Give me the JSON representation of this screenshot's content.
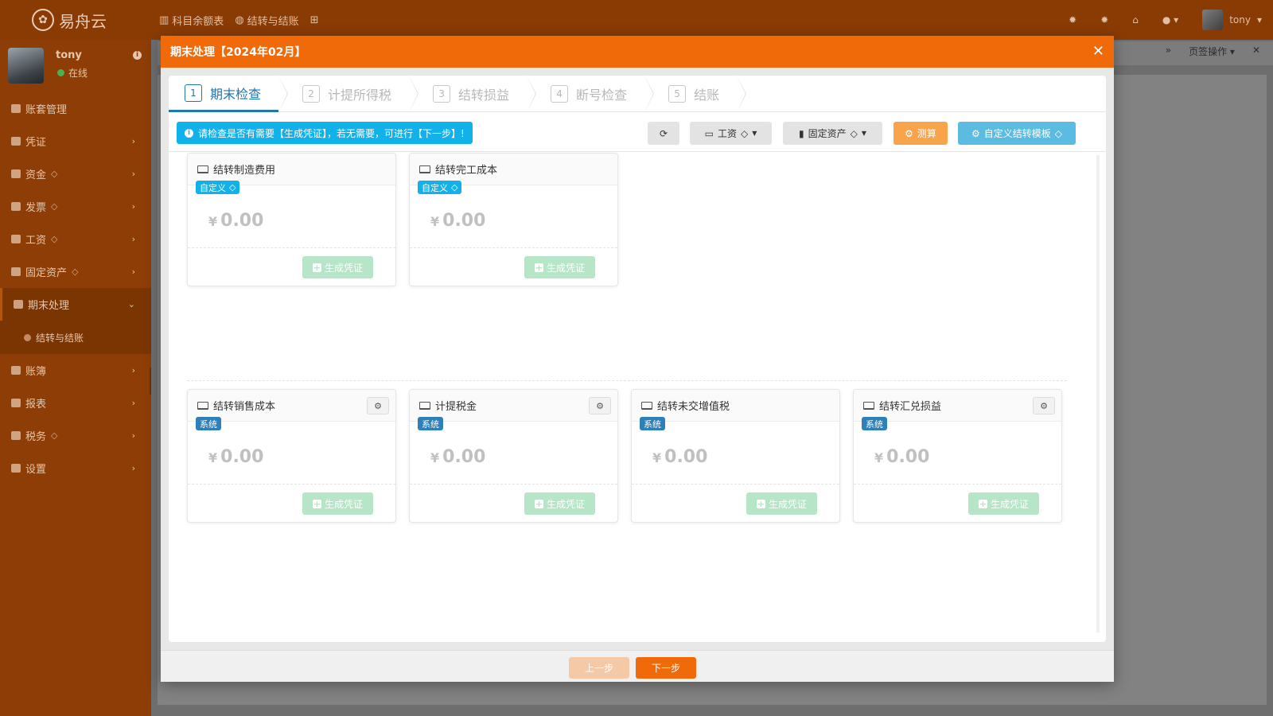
{
  "app": {
    "logo_text": "易舟云",
    "top_tabs": [
      "科目余额表",
      "结转与结账"
    ],
    "top_user": "tony",
    "page_ops": "页签操作"
  },
  "sidebar": {
    "user_name": "tony",
    "user_status": "在线",
    "items": [
      {
        "label": "账套管理"
      },
      {
        "label": "凭证"
      },
      {
        "label": "资金"
      },
      {
        "label": "发票"
      },
      {
        "label": "工资"
      },
      {
        "label": "固定资产"
      },
      {
        "label": "期末处理"
      },
      {
        "label": "结转与结账"
      },
      {
        "label": "账簿"
      },
      {
        "label": "报表"
      },
      {
        "label": "税务"
      },
      {
        "label": "设置"
      }
    ]
  },
  "modal": {
    "title": "期末处理【2024年02月】",
    "steps": [
      {
        "num": "1",
        "label": "期末检查"
      },
      {
        "num": "2",
        "label": "计提所得税"
      },
      {
        "num": "3",
        "label": "结转损益"
      },
      {
        "num": "4",
        "label": "断号检查"
      },
      {
        "num": "5",
        "label": "结账"
      }
    ],
    "alert": "请检查是否有需要【生成凭证】，若无需要，可进行【下一步】!",
    "toolbar": {
      "salary": "工资",
      "fixed_assets": "固定资产",
      "calculate": "测算",
      "custom_template": "自定义结转模板"
    },
    "cards": [
      {
        "title": "结转制造费用",
        "badge": "自定义",
        "amount": "0.00",
        "button": "生成凭证"
      },
      {
        "title": "结转完工成本",
        "badge": "自定义",
        "amount": "0.00",
        "button": "生成凭证"
      },
      {
        "title": "结转销售成本",
        "badge": "系统",
        "amount": "0.00",
        "button": "生成凭证"
      },
      {
        "title": "计提税金",
        "badge": "系统",
        "amount": "0.00",
        "button": "生成凭证"
      },
      {
        "title": "结转未交增值税",
        "badge": "系统",
        "amount": "0.00",
        "button": "生成凭证"
      },
      {
        "title": "结转汇兑损益",
        "badge": "系统",
        "amount": "0.00",
        "button": "生成凭证"
      }
    ],
    "currency_symbol": "¥",
    "footer": {
      "prev": "上一步",
      "next": "下一步"
    }
  },
  "colors": {
    "accent": "#f16a0a",
    "info": "#11b2ea",
    "system_badge": "#2f7fb8",
    "generate_disabled": "#b6e6c7"
  },
  "icons": {
    "diamond": "diamond-icon",
    "gear": "gear-icon",
    "laptop": "laptop-icon",
    "close": "close-icon",
    "refresh": "refresh-icon"
  }
}
